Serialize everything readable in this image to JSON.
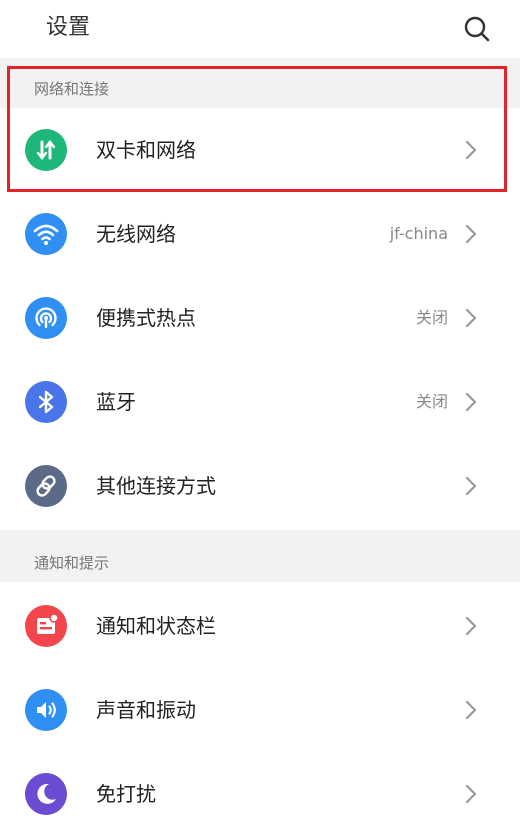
{
  "header": {
    "title": "设置"
  },
  "sections": [
    {
      "title": "网络和连接",
      "items": [
        {
          "label": "双卡和网络",
          "value": "",
          "icon": "dual-sim-icon",
          "color": "#1db77a"
        },
        {
          "label": "无线网络",
          "value": "jf-china",
          "icon": "wifi-icon",
          "color": "#2f8ff3"
        },
        {
          "label": "便携式热点",
          "value": "关闭",
          "icon": "hotspot-icon",
          "color": "#2f8ff3"
        },
        {
          "label": "蓝牙",
          "value": "关闭",
          "icon": "bluetooth-icon",
          "color": "#4a74ea"
        },
        {
          "label": "其他连接方式",
          "value": "",
          "icon": "link-icon",
          "color": "#5b6b87"
        }
      ]
    },
    {
      "title": "通知和提示",
      "items": [
        {
          "label": "通知和状态栏",
          "value": "",
          "icon": "notification-icon",
          "color": "#f2454c"
        },
        {
          "label": "声音和振动",
          "value": "",
          "icon": "sound-icon",
          "color": "#2f8ff3"
        },
        {
          "label": "免打扰",
          "value": "",
          "icon": "moon-icon",
          "color": "#6a4bd1"
        }
      ]
    }
  ],
  "highlight_color": "#e0242a"
}
